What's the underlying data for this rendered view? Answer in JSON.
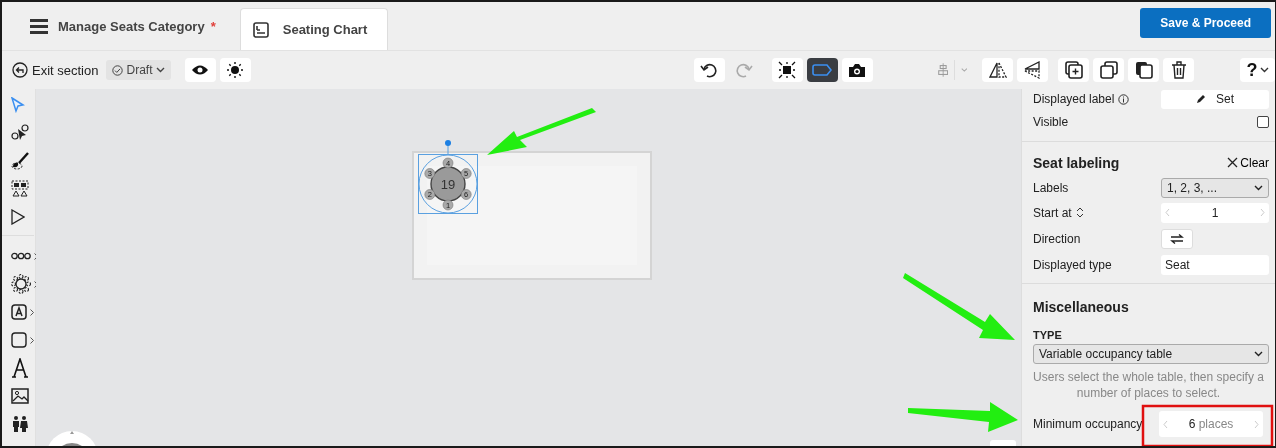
{
  "header": {
    "menu_title": "Manage Seats Category",
    "required_mark": "*",
    "tabs": [
      {
        "label": "Seating Chart",
        "selected": true
      }
    ],
    "save_button": "Save & Proceed"
  },
  "toolbar": {
    "exit": "Exit section",
    "status": "Draft",
    "tools": [
      {
        "kind": "preview",
        "selected": false,
        "disabled": false
      },
      {
        "kind": "theme",
        "selected": false,
        "disabled": false
      },
      {
        "kind": "undo",
        "selected": false,
        "disabled": false
      },
      {
        "kind": "redo",
        "selected": false,
        "disabled": true
      },
      {
        "kind": "focus",
        "selected": false,
        "disabled": false
      },
      {
        "kind": "label",
        "selected": true,
        "disabled": false
      },
      {
        "kind": "snapshot",
        "selected": false,
        "disabled": false
      },
      {
        "kind": "align",
        "selected": false,
        "disabled": true
      },
      {
        "kind": "flip-h",
        "selected": false,
        "disabled": false
      },
      {
        "kind": "flip-v",
        "selected": false,
        "disabled": false
      },
      {
        "kind": "add",
        "selected": false,
        "disabled": false
      },
      {
        "kind": "duplicate",
        "selected": false,
        "disabled": false
      },
      {
        "kind": "paste",
        "selected": false,
        "disabled": false
      },
      {
        "kind": "delete",
        "selected": false,
        "disabled": false
      },
      {
        "kind": "help",
        "selected": false,
        "disabled": false,
        "label": "?"
      }
    ]
  },
  "sidebar": {
    "items": [
      {
        "kind": "select",
        "selected": true,
        "submenu": false
      },
      {
        "kind": "select-seats",
        "selected": false,
        "submenu": false
      },
      {
        "kind": "brush",
        "selected": false,
        "submenu": false
      },
      {
        "kind": "select-group",
        "selected": false,
        "submenu": false
      },
      {
        "kind": "pointer",
        "selected": false,
        "submenu": false
      },
      {
        "kind": "row",
        "selected": false,
        "submenu": true
      },
      {
        "kind": "round-table",
        "selected": false,
        "submenu": true
      },
      {
        "kind": "text-box",
        "selected": false,
        "submenu": true
      },
      {
        "kind": "shape",
        "selected": false,
        "submenu": true
      },
      {
        "kind": "text",
        "selected": false,
        "submenu": false
      },
      {
        "kind": "image",
        "selected": false,
        "submenu": false
      },
      {
        "kind": "people",
        "selected": false,
        "submenu": false
      }
    ]
  },
  "canvas": {
    "table": {
      "label": "19",
      "seats": [
        "1",
        "2",
        "3",
        "4",
        "5",
        "6"
      ]
    }
  },
  "panel": {
    "displayed_label": {
      "label": "Displayed label",
      "button": "Set"
    },
    "visible": {
      "label": "Visible",
      "checked": false
    },
    "seat_labeling": {
      "title": "Seat labeling",
      "clear": "Clear",
      "labels_label": "Labels",
      "labels_value": "1, 2, 3, ...",
      "start_label": "Start at",
      "start_value": "1",
      "direction_label": "Direction",
      "type_label": "Displayed type",
      "type_value": "Seat"
    },
    "miscellaneous": {
      "title": "Miscellaneous",
      "type_heading": "TYPE",
      "type_value": "Variable occupancy table",
      "help": "Users select the whole table, then specify a number of places to select.",
      "min_label": "Minimum occupancy",
      "min_value": "6",
      "min_unit": "places"
    }
  }
}
